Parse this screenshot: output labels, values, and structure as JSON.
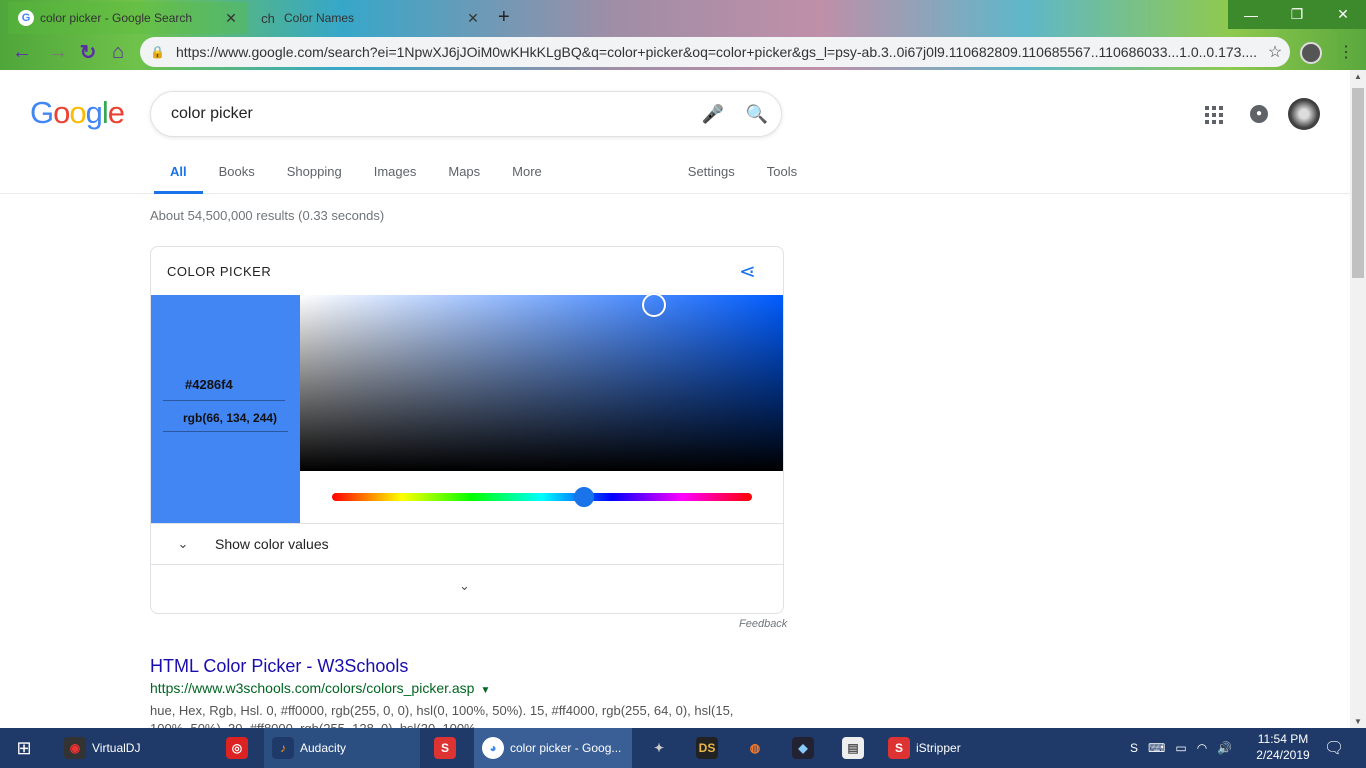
{
  "browser": {
    "tabs": [
      {
        "title": "color picker - Google Search",
        "close": "✕"
      },
      {
        "favicon_text": "ch",
        "title": "Color Names",
        "close": "✕"
      }
    ],
    "new_tab": "+",
    "window_controls": {
      "minimize": "—",
      "restore": "❐",
      "close": "✕"
    },
    "url": "https://www.google.com/search?ei=1NpwXJ6jJOiM0wKHkKLgBQ&q=color+picker&oq=color+picker&gs_l=psy-ab.3..0i67j0l9.110682809.110685567..110686033...1.0..0.173...."
  },
  "google": {
    "search_query": "color picker",
    "nav_tabs": [
      "All",
      "Books",
      "Shopping",
      "Images",
      "Maps",
      "More"
    ],
    "nav_tools": [
      "Settings",
      "Tools"
    ],
    "result_stats": "About 54,500,000 results (0.33 seconds)"
  },
  "color_picker": {
    "title": "COLOR PICKER",
    "hex": "#4286f4",
    "rgb": "rgb(66, 134, 244)",
    "swatch_color": "#4286f4",
    "hue_position": 0.6,
    "show_values_label": "Show color values",
    "feedback": "Feedback"
  },
  "result": {
    "title": "HTML Color Picker - W3Schools",
    "url": "https://www.w3schools.com/colors/colors_picker.asp",
    "snippet": "hue, Hex, Rgb, Hsl. 0, #ff0000, rgb(255, 0, 0), hsl(0, 100%, 50%). 15, #ff4000, rgb(255, 64, 0), hsl(15, 100%, 50%). 30, #ff8000, rgb(255, 128, 0), hsl(30, 100%"
  },
  "taskbar": {
    "items": [
      "VirtualDJ",
      "Audacity",
      "color picker - Goog...",
      "iStripper"
    ],
    "clock_time": "11:54 PM",
    "clock_date": "2/24/2019"
  }
}
